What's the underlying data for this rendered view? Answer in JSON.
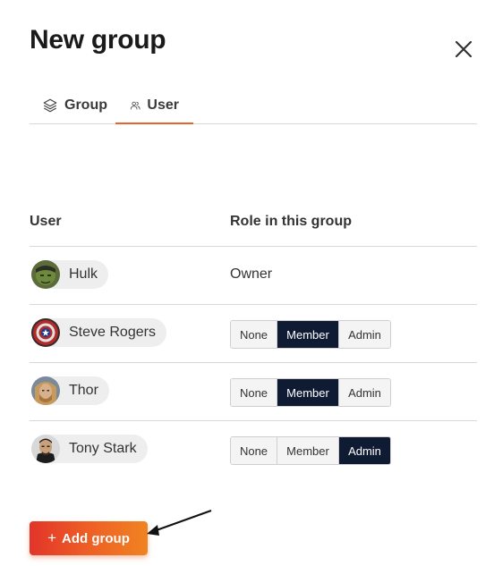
{
  "dialog": {
    "title": "New group"
  },
  "tabs": [
    {
      "label": "Group",
      "icon": "layers-icon",
      "active": false
    },
    {
      "label": "User",
      "icon": "users-icon",
      "active": true
    }
  ],
  "table": {
    "headers": {
      "user": "User",
      "role": "Role in this group"
    },
    "role_options": [
      "None",
      "Member",
      "Admin"
    ],
    "rows": [
      {
        "name": "Hulk",
        "role": "Owner"
      },
      {
        "name": "Steve Rogers",
        "role": "Member"
      },
      {
        "name": "Thor",
        "role": "Member"
      },
      {
        "name": "Tony Stark",
        "role": "Admin"
      }
    ]
  },
  "footer": {
    "add_label": "Add group",
    "add_icon": "plus-icon"
  },
  "colors": {
    "tab_underline": "#e8642c",
    "segment_active": "#0f1a33",
    "button_gradient_start": "#e2342a",
    "button_gradient_end": "#f08322"
  }
}
